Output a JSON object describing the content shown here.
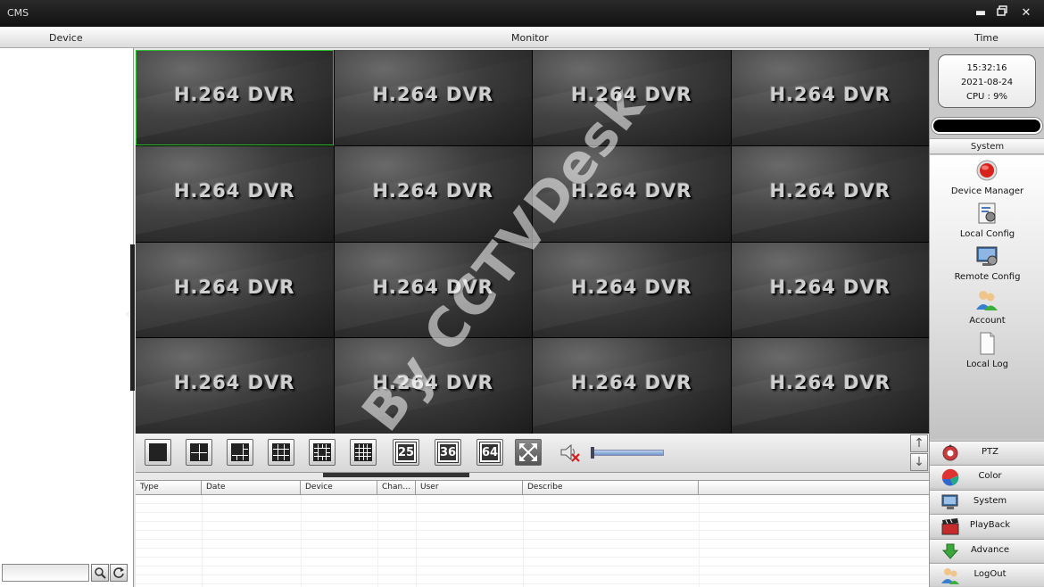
{
  "window": {
    "title": "CMS",
    "minimize_glyph": "▬",
    "restore_glyph": "▪",
    "close_glyph": "✕"
  },
  "header": {
    "device_label": "Device",
    "monitor_label": "Monitor",
    "time_label": "Time"
  },
  "left_panel": {
    "search_placeholder": "",
    "search_icon": "search-icon",
    "refresh_icon": "refresh-icon",
    "collapse_glyph": "‹"
  },
  "video_grid": {
    "tiles": [
      "H.264 DVR",
      "H.264 DVR",
      "H.264 DVR",
      "H.264 DVR",
      "H.264 DVR",
      "H.264 DVR",
      "H.264 DVR",
      "H.264 DVR",
      "H.264 DVR",
      "H.264 DVR",
      "H.264 DVR",
      "H.264 DVR",
      "H.264 DVR",
      "H.264 DVR",
      "H.264 DVR",
      "H.264 DVR"
    ],
    "selected_tile_index": 0,
    "watermark": "By CCTVDesk"
  },
  "toolbar": {
    "layout_buttons": [
      "1-split",
      "4-split",
      "6-split",
      "9-split",
      "8-split",
      "16-split"
    ],
    "num_buttons": [
      "25",
      "36",
      "64"
    ],
    "volume_level": 0.0,
    "up_glyph": "↑",
    "down_glyph": "↓"
  },
  "log_table": {
    "columns": [
      "Type",
      "Date",
      "Device",
      "Chan…",
      "User",
      "Describe",
      ""
    ]
  },
  "right_panel": {
    "clock_time": "15:32:16",
    "clock_date": "2021-08-24",
    "cpu_text": "CPU : 9%",
    "system_header": "System",
    "system_items": [
      "Device Manager",
      "Local Config",
      "Remote Config",
      "Account",
      "Local Log"
    ],
    "nav_buttons": [
      "PTZ",
      "Color",
      "System",
      "PlayBack",
      "Advance",
      "LogOut"
    ]
  },
  "colors": {
    "selected_tile": "#2ec12e",
    "volume_fill": "#6e95c9",
    "titlebar": "#111111"
  }
}
